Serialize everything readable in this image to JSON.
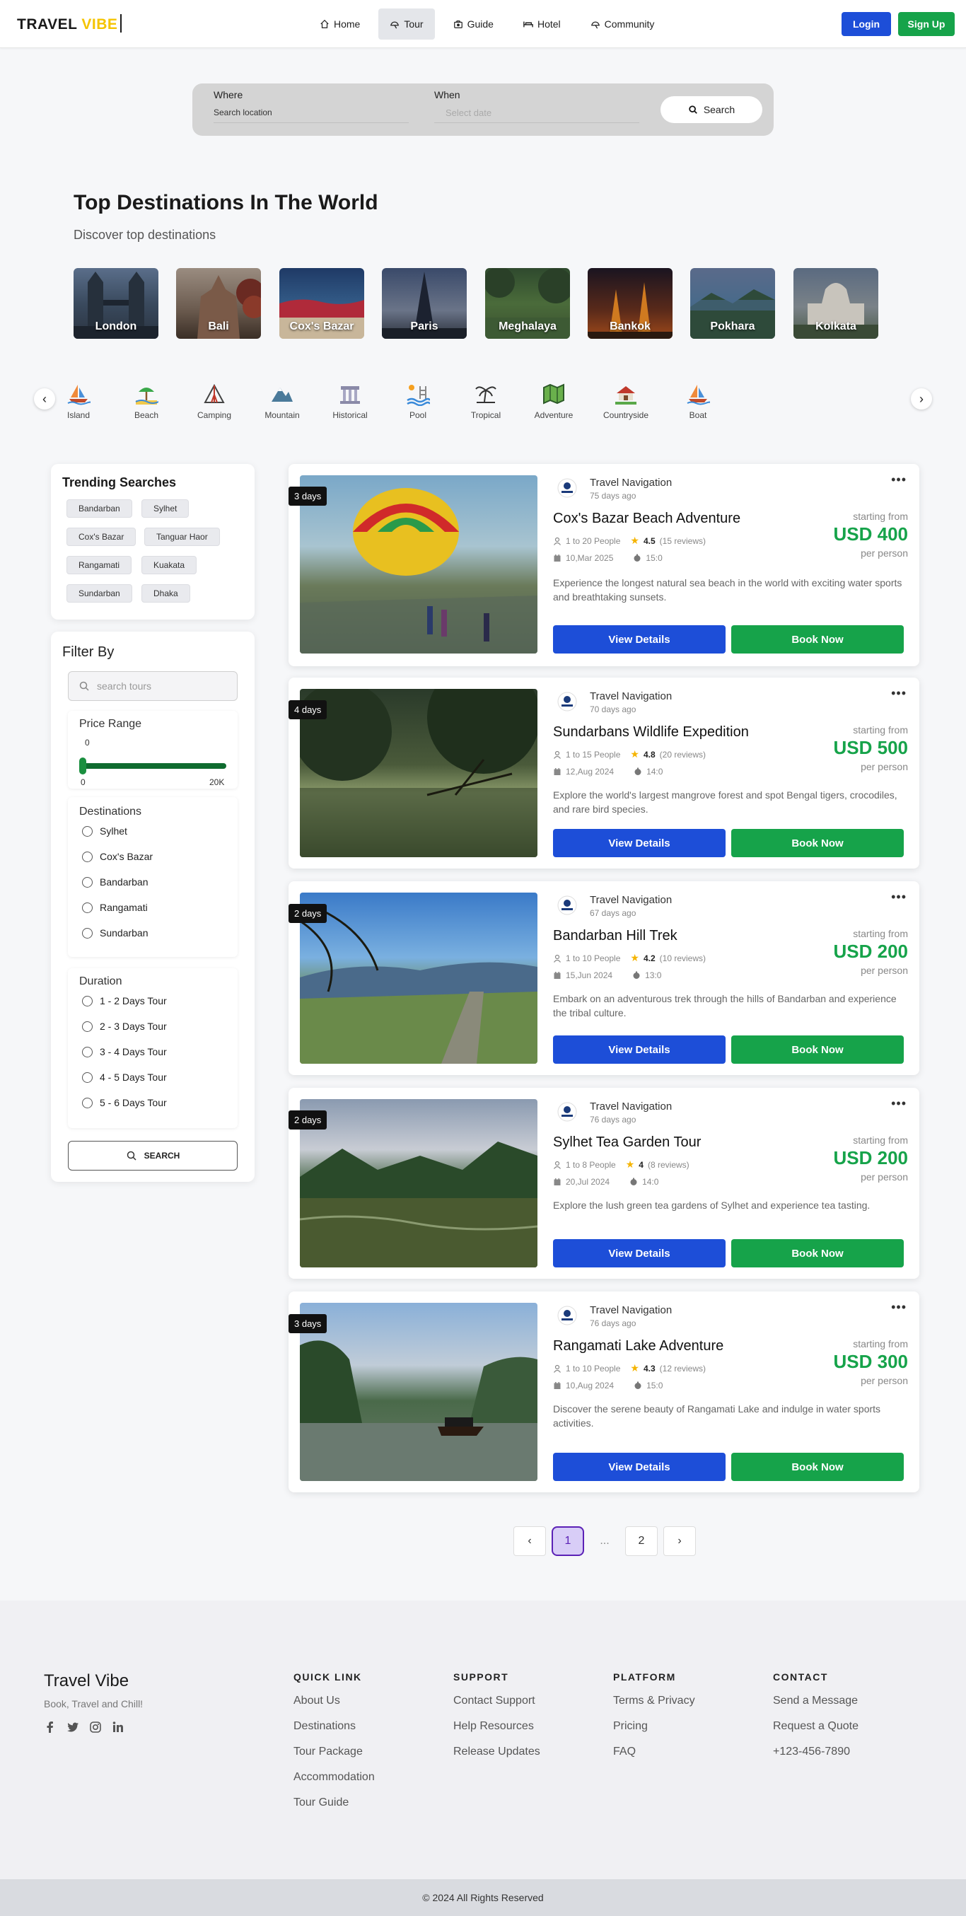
{
  "brand": {
    "part1": "TRAVEL",
    "part2": "VIBE"
  },
  "nav": {
    "items": [
      {
        "label": "Home",
        "icon": "home-icon"
      },
      {
        "label": "Tour",
        "icon": "tour-icon",
        "active": true
      },
      {
        "label": "Guide",
        "icon": "guide-icon"
      },
      {
        "label": "Hotel",
        "icon": "hotel-icon"
      },
      {
        "label": "Community",
        "icon": "community-icon"
      }
    ],
    "login": "Login",
    "signup": "Sign Up"
  },
  "search": {
    "where_label": "Where",
    "where_value": "Search location",
    "when_label": "When",
    "when_placeholder": "Select date",
    "button": "Search"
  },
  "destinations": {
    "title": "Top Destinations In The World",
    "subtitle": "Discover top destinations",
    "items": [
      "London",
      "Bali",
      "Cox's Bazar",
      "Paris",
      "Meghalaya",
      "Bankok",
      "Pokhara",
      "Kolkata"
    ]
  },
  "categories": [
    "Island",
    "Beach",
    "Camping",
    "Mountain",
    "Historical",
    "Pool",
    "Tropical",
    "Adventure",
    "Countryside",
    "Boat"
  ],
  "trending": {
    "title": "Trending Searches",
    "chips": [
      "Bandarban",
      "Sylhet",
      "Cox's Bazar",
      "Tanguar Haor",
      "Rangamati",
      "Kuakata",
      "Sundarban",
      "Dhaka"
    ]
  },
  "filter": {
    "title": "Filter By",
    "search_placeholder": "search tours",
    "price_title": "Price Range",
    "price_value": "0",
    "price_min": "0",
    "price_max": "20K",
    "price_level": 0,
    "dest_title": "Destinations",
    "destinations": [
      "Sylhet",
      "Cox's Bazar",
      "Bandarban",
      "Rangamati",
      "Sundarban"
    ],
    "duration_title": "Duration",
    "durations": [
      "1 - 2 Days Tour",
      "2 - 3 Days Tour",
      "3 - 4 Days Tour",
      "4 - 5 Days Tour",
      "5 - 6 Days Tour"
    ],
    "button": "SEARCH"
  },
  "tours": [
    {
      "days": "3 days",
      "agency": "Travel Navigation",
      "posted": "75 days ago",
      "title": "Cox's Bazar Beach Adventure",
      "people": "1 to 20 People",
      "rating": "4.5",
      "reviews": "(15 reviews)",
      "date": "10,Mar 2025",
      "time": "15:0",
      "from": "starting from",
      "price": "USD 400",
      "per": "per person",
      "desc": "Experience the longest natural sea beach in the world with exciting water sports and breathtaking sunsets.",
      "view": "View Details",
      "book": "Book Now"
    },
    {
      "days": "4 days",
      "agency": "Travel Navigation",
      "posted": "70 days ago",
      "title": "Sundarbans Wildlife Expedition",
      "people": "1 to 15 People",
      "rating": "4.8",
      "reviews": "(20 reviews)",
      "date": "12,Aug 2024",
      "time": "14:0",
      "from": "starting from",
      "price": "USD 500",
      "per": "per person",
      "desc": "Explore the world's largest mangrove forest and spot Bengal tigers, crocodiles, and rare bird species.",
      "view": "View Details",
      "book": "Book Now"
    },
    {
      "days": "2 days",
      "agency": "Travel Navigation",
      "posted": "67 days ago",
      "title": "Bandarban Hill Trek",
      "people": "1 to 10 People",
      "rating": "4.2",
      "reviews": "(10 reviews)",
      "date": "15,Jun 2024",
      "time": "13:0",
      "from": "starting from",
      "price": "USD 200",
      "per": "per person",
      "desc": "Embark on an adventurous trek through the hills of Bandarban and experience the tribal culture.",
      "view": "View Details",
      "book": "Book Now"
    },
    {
      "days": "2 days",
      "agency": "Travel Navigation",
      "posted": "76 days ago",
      "title": "Sylhet Tea Garden Tour",
      "people": "1 to 8 People",
      "rating": "4",
      "reviews": "(8 reviews)",
      "date": "20,Jul 2024",
      "time": "14:0",
      "from": "starting from",
      "price": "USD 200",
      "per": "per person",
      "desc": "Explore the lush green tea gardens of Sylhet and experience tea tasting.",
      "view": "View Details",
      "book": "Book Now"
    },
    {
      "days": "3 days",
      "agency": "Travel Navigation",
      "posted": "76 days ago",
      "title": "Rangamati Lake Adventure",
      "people": "1 to 10 People",
      "rating": "4.3",
      "reviews": "(12 reviews)",
      "date": "10,Aug 2024",
      "time": "15:0",
      "from": "starting from",
      "price": "USD 300",
      "per": "per person",
      "desc": "Discover the serene beauty of Rangamati Lake and indulge in water sports activities.",
      "view": "View Details",
      "book": "Book Now"
    }
  ],
  "pagination": {
    "pages": [
      "1",
      "...",
      "2"
    ],
    "current": "1"
  },
  "footer": {
    "brand": "Travel Vibe",
    "tagline": "Book, Travel and Chill!",
    "social": [
      "facebook-icon",
      "twitter-icon",
      "instagram-icon",
      "linkedin-icon"
    ],
    "columns": [
      {
        "title": "QUICK LINK",
        "links": [
          "About Us",
          "Destinations",
          "Tour Package",
          "Accommodation",
          "Tour Guide"
        ]
      },
      {
        "title": "SUPPORT",
        "links": [
          "Contact Support",
          "Help Resources",
          "Release Updates"
        ]
      },
      {
        "title": "PLATFORM",
        "links": [
          "Terms & Privacy",
          "Pricing",
          "FAQ"
        ]
      },
      {
        "title": "CONTACT",
        "links": [
          "Send a Message",
          "Request a Quote",
          "+123-456-7890"
        ]
      }
    ],
    "copyright": "© 2024 All Rights Reserved"
  },
  "colors": {
    "primary": "#1d4ed8",
    "success": "#16a34a",
    "accent": "#f5c400",
    "pagination_active": "#5b21b6"
  }
}
